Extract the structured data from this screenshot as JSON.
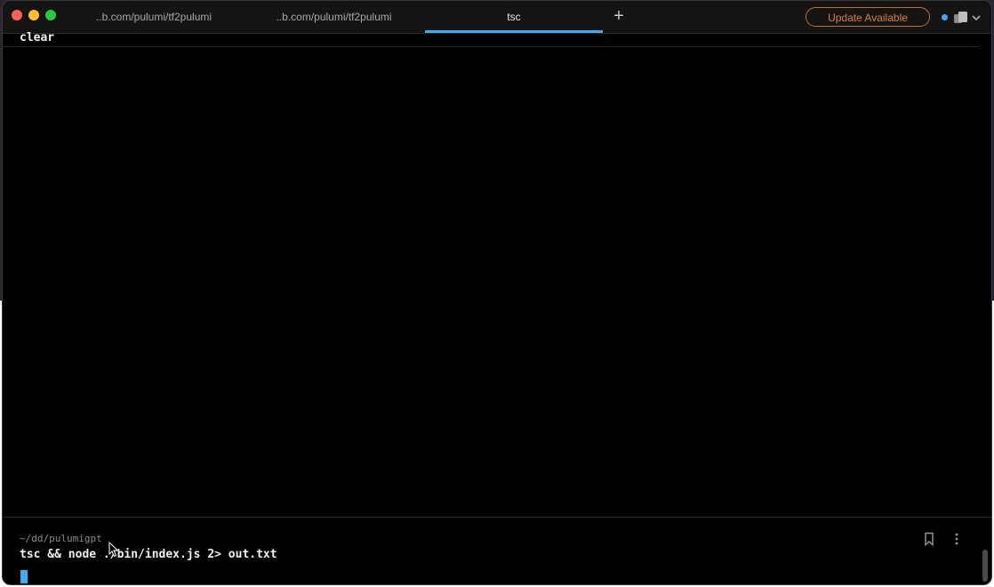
{
  "tabs": [
    {
      "label": "..b.com/pulumi/tf2pulumi"
    },
    {
      "label": "..b.com/pulumi/tf2pulumi"
    },
    {
      "label": "tsc",
      "active": true
    }
  ],
  "header": {
    "new_tab_symbol": "+",
    "update_label": "Update Available",
    "accent_color": "#3fa9f5",
    "update_color": "#d8823a"
  },
  "terminal": {
    "previous_block_command": "clear",
    "prompt_path": "~/dd/pulumigpt",
    "current_command": "tsc && node ./bin/index.js 2> out.txt"
  },
  "icons": {
    "close": "close-traffic-light",
    "minimize": "minimize-traffic-light",
    "zoom": "zoom-traffic-light",
    "bookmark": "bookmark-icon",
    "more": "more-vertical-icon",
    "profile": "profile-switch-icon"
  }
}
